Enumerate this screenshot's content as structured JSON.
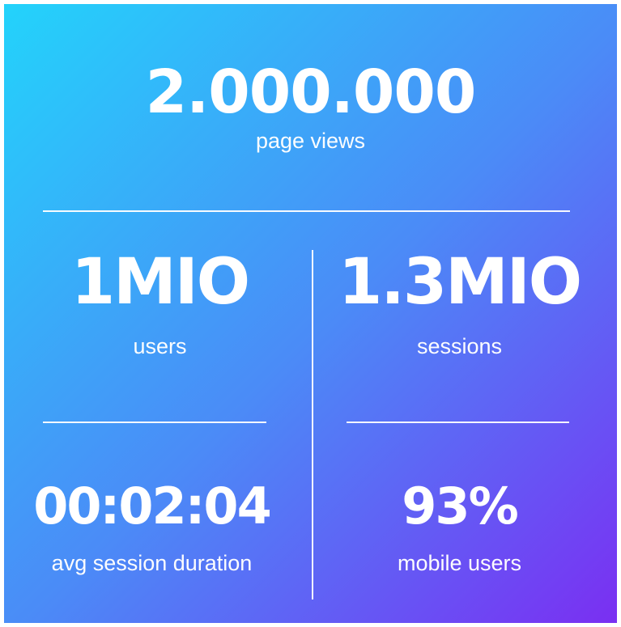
{
  "metrics": {
    "page_views": {
      "value": "2.000.000",
      "label": "page views"
    },
    "users": {
      "value": "1MIO",
      "label": "users"
    },
    "sessions": {
      "value": "1.3MIO",
      "label": "sessions"
    },
    "avg_session_duration": {
      "value": "00:02:04",
      "label": "avg session duration"
    },
    "mobile_users": {
      "value": "93%",
      "label": "mobile users"
    }
  },
  "colors": {
    "gradient_start": "#23d3fb",
    "gradient_mid": "#4b8bf7",
    "gradient_end": "#7a2ff2",
    "text": "#ffffff",
    "divider": "#ffffff"
  }
}
